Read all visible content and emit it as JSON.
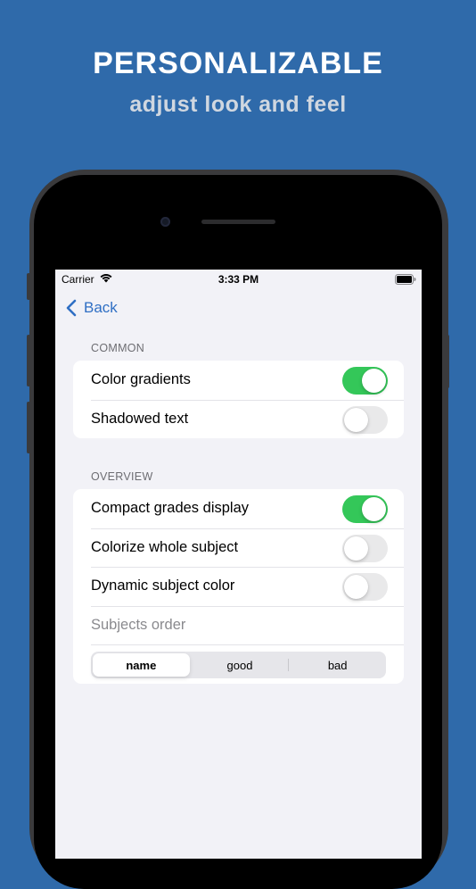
{
  "marketing": {
    "headline": "PERSONALIZABLE",
    "subheadline": "adjust look and feel"
  },
  "status_bar": {
    "carrier": "Carrier",
    "time": "3:33 PM"
  },
  "nav": {
    "back_label": "Back"
  },
  "sections": {
    "common": {
      "header": "COMMON",
      "rows": [
        {
          "label": "Color gradients",
          "toggle": true
        },
        {
          "label": "Shadowed text",
          "toggle": false
        }
      ]
    },
    "overview": {
      "header": "OVERVIEW",
      "rows": [
        {
          "label": "Compact grades display",
          "toggle": true
        },
        {
          "label": "Colorize whole subject",
          "toggle": false
        },
        {
          "label": "Dynamic subject color",
          "toggle": false
        }
      ],
      "subjects_order_label": "Subjects order",
      "subjects_order_options": [
        "name",
        "good",
        "bad"
      ],
      "subjects_order_selected": "name"
    }
  },
  "colors": {
    "background": "#2f6aaa",
    "accent": "#2f6fc4",
    "toggle_on": "#34c759",
    "toggle_off": "#e9e9ea"
  }
}
